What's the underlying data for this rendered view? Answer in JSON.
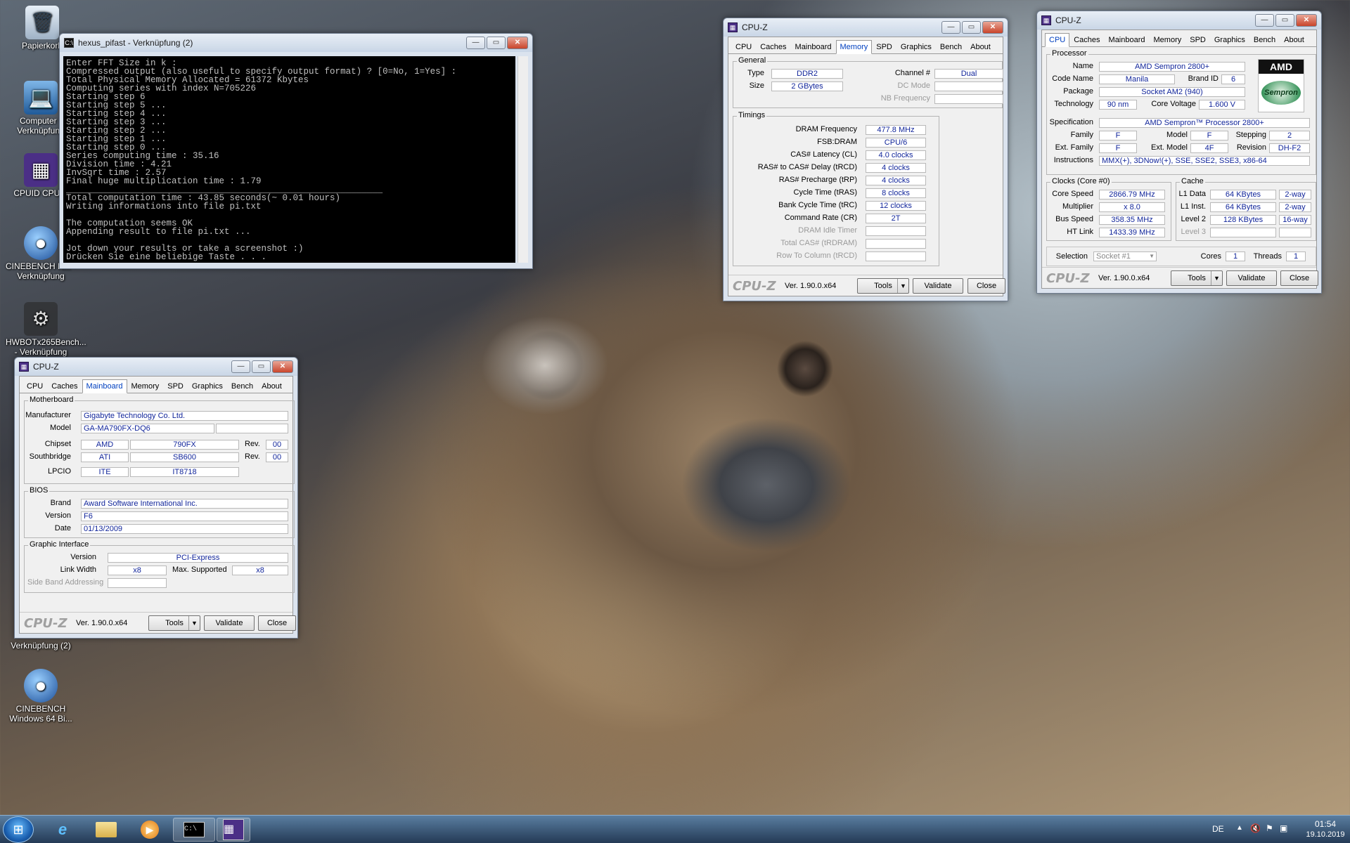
{
  "desktop": {
    "icons": [
      {
        "label": "Papierkorb",
        "glyph": "🗑"
      },
      {
        "label": "Computer - Verknüpfung",
        "glyph": "💻"
      },
      {
        "label": "CPUID CPU-Z",
        "glyph": "▦"
      },
      {
        "label": "CINEBENCH R... - Verknüpfung",
        "glyph": "●"
      },
      {
        "label": "HWBOTx265Bench... - Verknüpfung",
        "glyph": "⚙"
      },
      {
        "label": "Verknüpfung (2)",
        "glyph": ""
      },
      {
        "label": "CINEBENCH Windows 64 Bi...",
        "glyph": "●"
      }
    ]
  },
  "console": {
    "title": "hexus_pifast - Verknüpfung (2)",
    "icon": "C:\\",
    "text": "Enter FFT Size in k :\nCompressed output (also useful to specify output format) ? [0=No, 1=Yes] :\nTotal Physical Memory Allocated = 61372 Kbytes\nComputing series with index N=705226\nStarting step 6\nStarting step 5 ...\nStarting step 4 ...\nStarting step 3 ...\nStarting step 2 ...\nStarting step 1 ...\nStarting step 0 ...\nSeries computing time : 35.16\nDivision time : 4.21\nInvSqrt time : 2.57\nFinal huge multiplication time : 1.79\n____________________________________________________________\nTotal computation time : 43.85 seconds(~ 0.01 hours)\nWriting informations into file pi.txt\n\nThe computation seems OK\nAppending result to file pi.txt ...\n\nJot down your results or take a screenshot :)\nDrücken Sie eine beliebige Taste . . ."
  },
  "cpuz_common": {
    "title": "CPU-Z",
    "tabs": [
      "CPU",
      "Caches",
      "Mainboard",
      "Memory",
      "SPD",
      "Graphics",
      "Bench",
      "About"
    ],
    "brand": "CPU-Z",
    "version": "Ver. 1.90.0.x64",
    "tools": "Tools",
    "validate": "Validate",
    "close": "Close"
  },
  "mainboard": {
    "motherboard_label": "Motherboard",
    "manufacturer_label": "Manufacturer",
    "manufacturer": "Gigabyte Technology Co. Ltd.",
    "model_label": "Model",
    "model": "GA-MA790FX-DQ6",
    "chipset_label": "Chipset",
    "chipset_vendor": "AMD",
    "chipset_model": "790FX",
    "chipset_rev": "00",
    "southbridge_label": "Southbridge",
    "sb_vendor": "ATI",
    "sb_model": "SB600",
    "sb_rev": "00",
    "rev_label": "Rev.",
    "lpcio_label": "LPCIO",
    "lpcio_vendor": "ITE",
    "lpcio_model": "IT8718",
    "bios_label": "BIOS",
    "brand_label": "Brand",
    "bios_brand": "Award Software International Inc.",
    "version_label": "Version",
    "bios_version": "F6",
    "date_label": "Date",
    "bios_date": "01/13/2009",
    "gi_label": "Graphic Interface",
    "gi_version_label": "Version",
    "gi_version": "PCI-Express",
    "link_width_label": "Link Width",
    "link_width": "x8",
    "max_supported_label": "Max. Supported",
    "max_supported": "x8",
    "sba_label": "Side Band Addressing"
  },
  "memory": {
    "general_label": "General",
    "type_label": "Type",
    "type": "DDR2",
    "size_label": "Size",
    "size": "2 GBytes",
    "channel_label": "Channel #",
    "channel": "Dual",
    "dcmode_label": "DC Mode",
    "nbfreq_label": "NB Frequency",
    "timings_label": "Timings",
    "rows": [
      {
        "label": "DRAM Frequency",
        "value": "477.8 MHz",
        "dim": false
      },
      {
        "label": "FSB:DRAM",
        "value": "CPU/6",
        "dim": false
      },
      {
        "label": "CAS# Latency (CL)",
        "value": "4.0 clocks",
        "dim": false
      },
      {
        "label": "RAS# to CAS# Delay (tRCD)",
        "value": "4 clocks",
        "dim": false
      },
      {
        "label": "RAS# Precharge (tRP)",
        "value": "4 clocks",
        "dim": false
      },
      {
        "label": "Cycle Time (tRAS)",
        "value": "8 clocks",
        "dim": false
      },
      {
        "label": "Bank Cycle Time (tRC)",
        "value": "12 clocks",
        "dim": false
      },
      {
        "label": "Command Rate (CR)",
        "value": "2T",
        "dim": false
      },
      {
        "label": "DRAM Idle Timer",
        "value": "",
        "dim": true
      },
      {
        "label": "Total CAS# (tRDRAM)",
        "value": "",
        "dim": true
      },
      {
        "label": "Row To Column (tRCD)",
        "value": "",
        "dim": true
      }
    ]
  },
  "cpu": {
    "processor_label": "Processor",
    "name_label": "Name",
    "name": "AMD Sempron 2800+",
    "codename_label": "Code Name",
    "codename": "Manila",
    "brandid_label": "Brand ID",
    "brandid": "6",
    "package_label": "Package",
    "package": "Socket AM2 (940)",
    "tech_label": "Technology",
    "tech": "90 nm",
    "voltage_label": "Core Voltage",
    "voltage": "1.600 V",
    "spec_label": "Specification",
    "spec": "AMD Sempron™ Processor 2800+",
    "family_label": "Family",
    "family": "F",
    "model_label": "Model",
    "model": "F",
    "stepping_label": "Stepping",
    "stepping": "2",
    "extfamily_label": "Ext. Family",
    "extfamily": "F",
    "extmodel_label": "Ext. Model",
    "extmodel": "4F",
    "revision_label": "Revision",
    "revision": "DH-F2",
    "instr_label": "Instructions",
    "instr": "MMX(+), 3DNow!(+), SSE, SSE2, SSE3, x86-64",
    "logo_top": "AMD",
    "logo_bottom": "Sempron",
    "clocks_label": "Clocks (Core #0)",
    "corespeed_label": "Core Speed",
    "corespeed": "2866.79 MHz",
    "multiplier_label": "Multiplier",
    "multiplier": "x 8.0",
    "busspeed_label": "Bus Speed",
    "busspeed": "358.35 MHz",
    "htlink_label": "HT Link",
    "htlink": "1433.39 MHz",
    "cache_label": "Cache",
    "l1d_label": "L1 Data",
    "l1d": "64 KBytes",
    "l1d_way": "2-way",
    "l1i_label": "L1 Inst.",
    "l1i": "64 KBytes",
    "l1i_way": "2-way",
    "l2_label": "Level 2",
    "l2": "128 KBytes",
    "l2_way": "16-way",
    "l3_label": "Level 3",
    "selection_label": "Selection",
    "selection": "Socket #1",
    "cores_label": "Cores",
    "cores": "1",
    "threads_label": "Threads",
    "threads": "1"
  },
  "taskbar": {
    "lang": "DE",
    "time": "01:54",
    "date": "19.10.2019"
  }
}
